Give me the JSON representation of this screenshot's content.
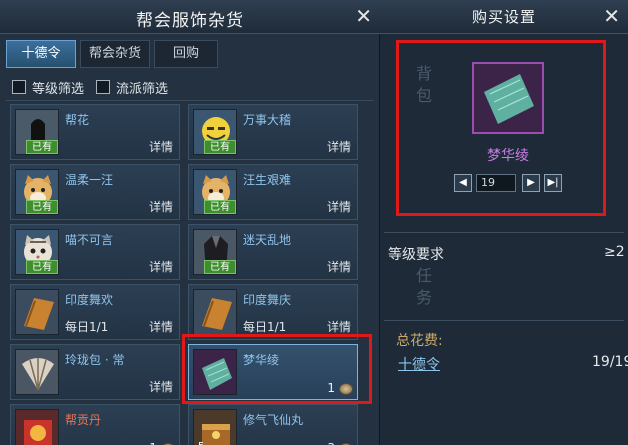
{
  "left": {
    "title": "帮会服饰杂货",
    "close": "✕",
    "tabs": [
      "十德令",
      "帮会杂货",
      "回购"
    ],
    "filters": [
      "等级筛选",
      "流派筛选"
    ],
    "items": [
      {
        "name": "帮花",
        "detail": "详情",
        "badge": "已有",
        "icon": "black-statue-icon",
        "sub": ""
      },
      {
        "name": "万事大稽",
        "detail": "详情",
        "badge": "已有",
        "icon": "grinning-face-icon",
        "sub": ""
      },
      {
        "name": "温柔一汪",
        "detail": "详情",
        "badge": "已有",
        "icon": "shiba-dog-icon",
        "sub": ""
      },
      {
        "name": "汪生艰难",
        "detail": "详情",
        "badge": "已有",
        "icon": "shiba-dog-icon",
        "sub": ""
      },
      {
        "name": "喵不可言",
        "detail": "详情",
        "badge": "已有",
        "icon": "cat-face-icon",
        "sub": ""
      },
      {
        "name": "迷天乱地",
        "detail": "详情",
        "badge": "已有",
        "icon": "dark-robe-icon",
        "sub": ""
      },
      {
        "name": "印度舞欢",
        "detail": "详情",
        "badge": "",
        "icon": "book-icon",
        "sub": "每日1/1"
      },
      {
        "name": "印度舞庆",
        "detail": "详情",
        "badge": "",
        "icon": "book-icon",
        "sub": "每日1/1"
      },
      {
        "name": "玲珑包 · 常",
        "detail": "详情",
        "badge": "",
        "icon": "fan-icon",
        "sub": ""
      },
      {
        "name": "梦华绫",
        "detail": "",
        "badge": "",
        "icon": "jade-cloth-icon",
        "sub": "",
        "count": "1"
      },
      {
        "name": "帮贡丹",
        "detail": "",
        "badge": "",
        "icon": "pill-box-icon",
        "sub": "",
        "count": "1"
      },
      {
        "name": "修气飞仙丸",
        "detail": "",
        "badge": "",
        "icon": "treasure-chest-icon",
        "sub": "",
        "count": "3",
        "corner": "5"
      }
    ]
  },
  "right": {
    "title": "购买设置",
    "close": "✕",
    "ghost1": "背",
    "ghost2": "包",
    "ghost3": "任",
    "ghost4": "务",
    "item_name": "梦华绫",
    "quantity": "19",
    "level_label": "等级要求",
    "level_value": "≥2",
    "cost_label": "总花费:",
    "currency": "十德令",
    "cost_value": "19/19"
  },
  "colors": {
    "highlight_box": "#e01818",
    "item_name": "#8fc4ec",
    "purple_name": "#c77de6",
    "owned_badge": "#3e8d2e"
  }
}
